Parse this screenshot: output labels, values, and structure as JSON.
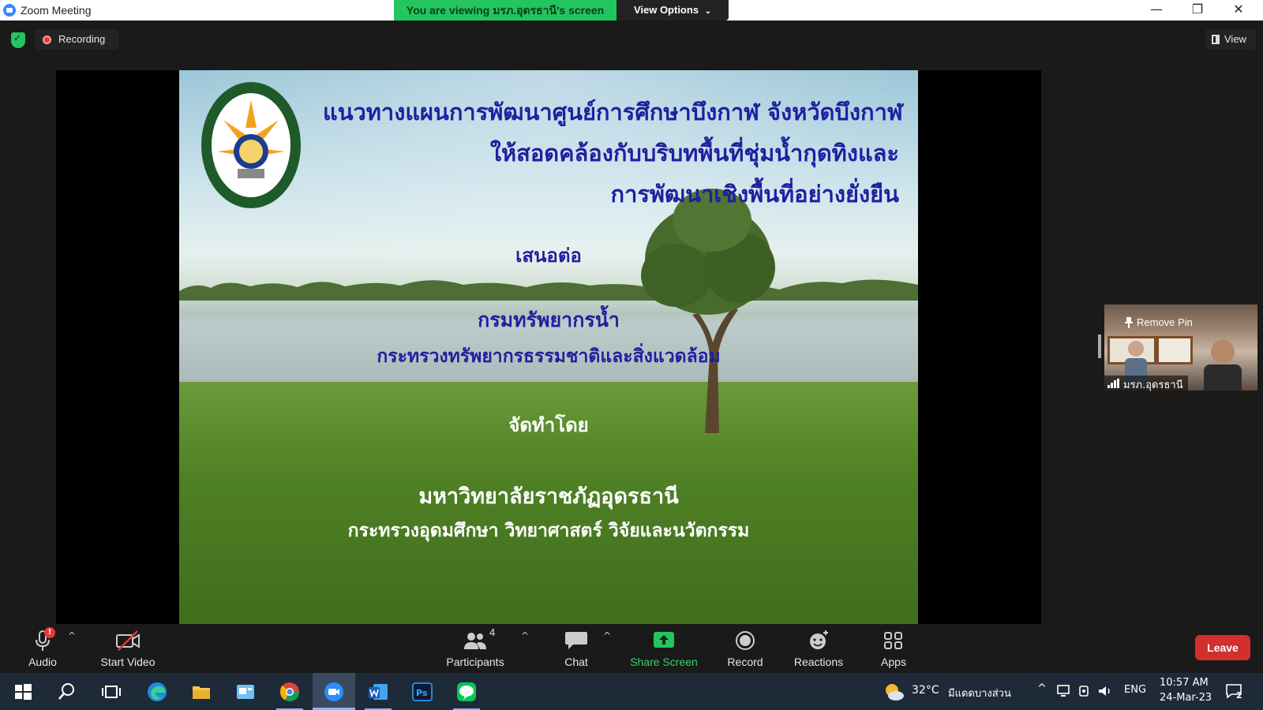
{
  "window": {
    "title": "Zoom Meeting",
    "share_banner": "You are viewing มรภ.อุดรธานี's screen",
    "view_options_label": "View Options",
    "minimize": "—",
    "restore": "❐",
    "close": "✕"
  },
  "status": {
    "recording_label": "Recording",
    "view_label": "View"
  },
  "slide": {
    "title_line1": "แนวทางแผนการพัฒนาศูนย์การศึกษาบึงกาฬ จังหวัดบึงกาฬ",
    "title_line2": "ให้สอดคล้องกับบริบทพื้นที่ชุ่มน้ำกุดทิงและ",
    "title_line3": "การพัฒนาเชิงพื้นที่อย่างยั่งยืน",
    "presented_to": "เสนอต่อ",
    "department": "กรมทรัพยากรน้ำ",
    "ministry_env": "กระทรวงทรัพยากรธรรมชาติและสิ่งแวดล้อม",
    "prepared_by": "จัดทำโดย",
    "university": "มหาวิทยาลัยราชภัฏอุดรธานี",
    "ministry_edu": "กระทรวงอุดมศึกษา วิทยาศาสตร์ วิจัยและนวัตกรรม"
  },
  "participant_tile": {
    "remove_pin_label": "Remove Pin",
    "name": "มรภ.อุดรธานี"
  },
  "toolbar": {
    "audio_label": "Audio",
    "audio_badge": "!",
    "start_video_label": "Start Video",
    "participants_label": "Participants",
    "participants_count": "4",
    "chat_label": "Chat",
    "share_screen_label": "Share Screen",
    "record_label": "Record",
    "reactions_label": "Reactions",
    "apps_label": "Apps",
    "leave_label": "Leave",
    "caret": "^"
  },
  "taskbar": {
    "temperature": "32°C",
    "weather": "มีแดดบางส่วน",
    "language": "ENG",
    "time": "10:57 AM",
    "date": "24-Mar-23",
    "notification_count": "2",
    "tray_chevron": "^"
  },
  "colors": {
    "accent_green": "#23c55e",
    "leave_red": "#d32f2f",
    "slide_text_blue": "#1f1fa0"
  }
}
